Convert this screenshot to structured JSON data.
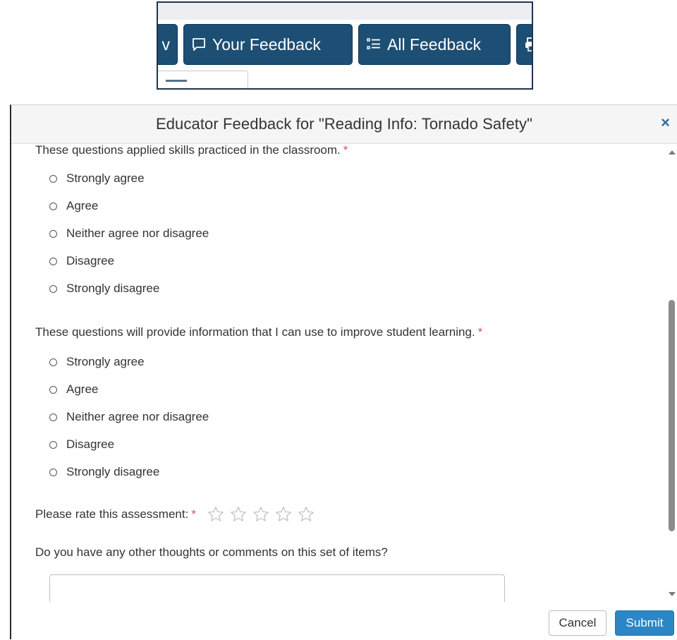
{
  "toolbar": {
    "partial_left_label": "v",
    "your_feedback_label": "Your Feedback",
    "all_feedback_label": "All Feedback",
    "your_feedback_icon": "comment-icon",
    "all_feedback_icon": "list-icon",
    "partial_right_icon": "print-icon",
    "button_color": "#1d4f75"
  },
  "modal": {
    "title": "Educator Feedback for \"Reading Info: Tornado Safety\"",
    "close_label": "×"
  },
  "questions": [
    {
      "text": "These questions applied skills practiced in the classroom.",
      "required_mark": "*",
      "options": [
        "Strongly agree",
        "Agree",
        "Neither agree nor disagree",
        "Disagree",
        "Strongly disagree"
      ]
    },
    {
      "text": "These questions will provide information that I can use to improve student learning.",
      "required_mark": "*",
      "options": [
        "Strongly agree",
        "Agree",
        "Neither agree nor disagree",
        "Disagree",
        "Strongly disagree"
      ]
    }
  ],
  "rating": {
    "label": "Please rate this assessment:",
    "required_mark": "*",
    "max_stars": 5,
    "selected": 0
  },
  "comments": {
    "label": "Do you have any other thoughts or comments on this set of items?",
    "value": ""
  },
  "footer": {
    "cancel_label": "Cancel",
    "submit_label": "Submit"
  },
  "colors": {
    "required": "#d9534f",
    "submit": "#2b86c5",
    "close": "#2f6fa3"
  }
}
